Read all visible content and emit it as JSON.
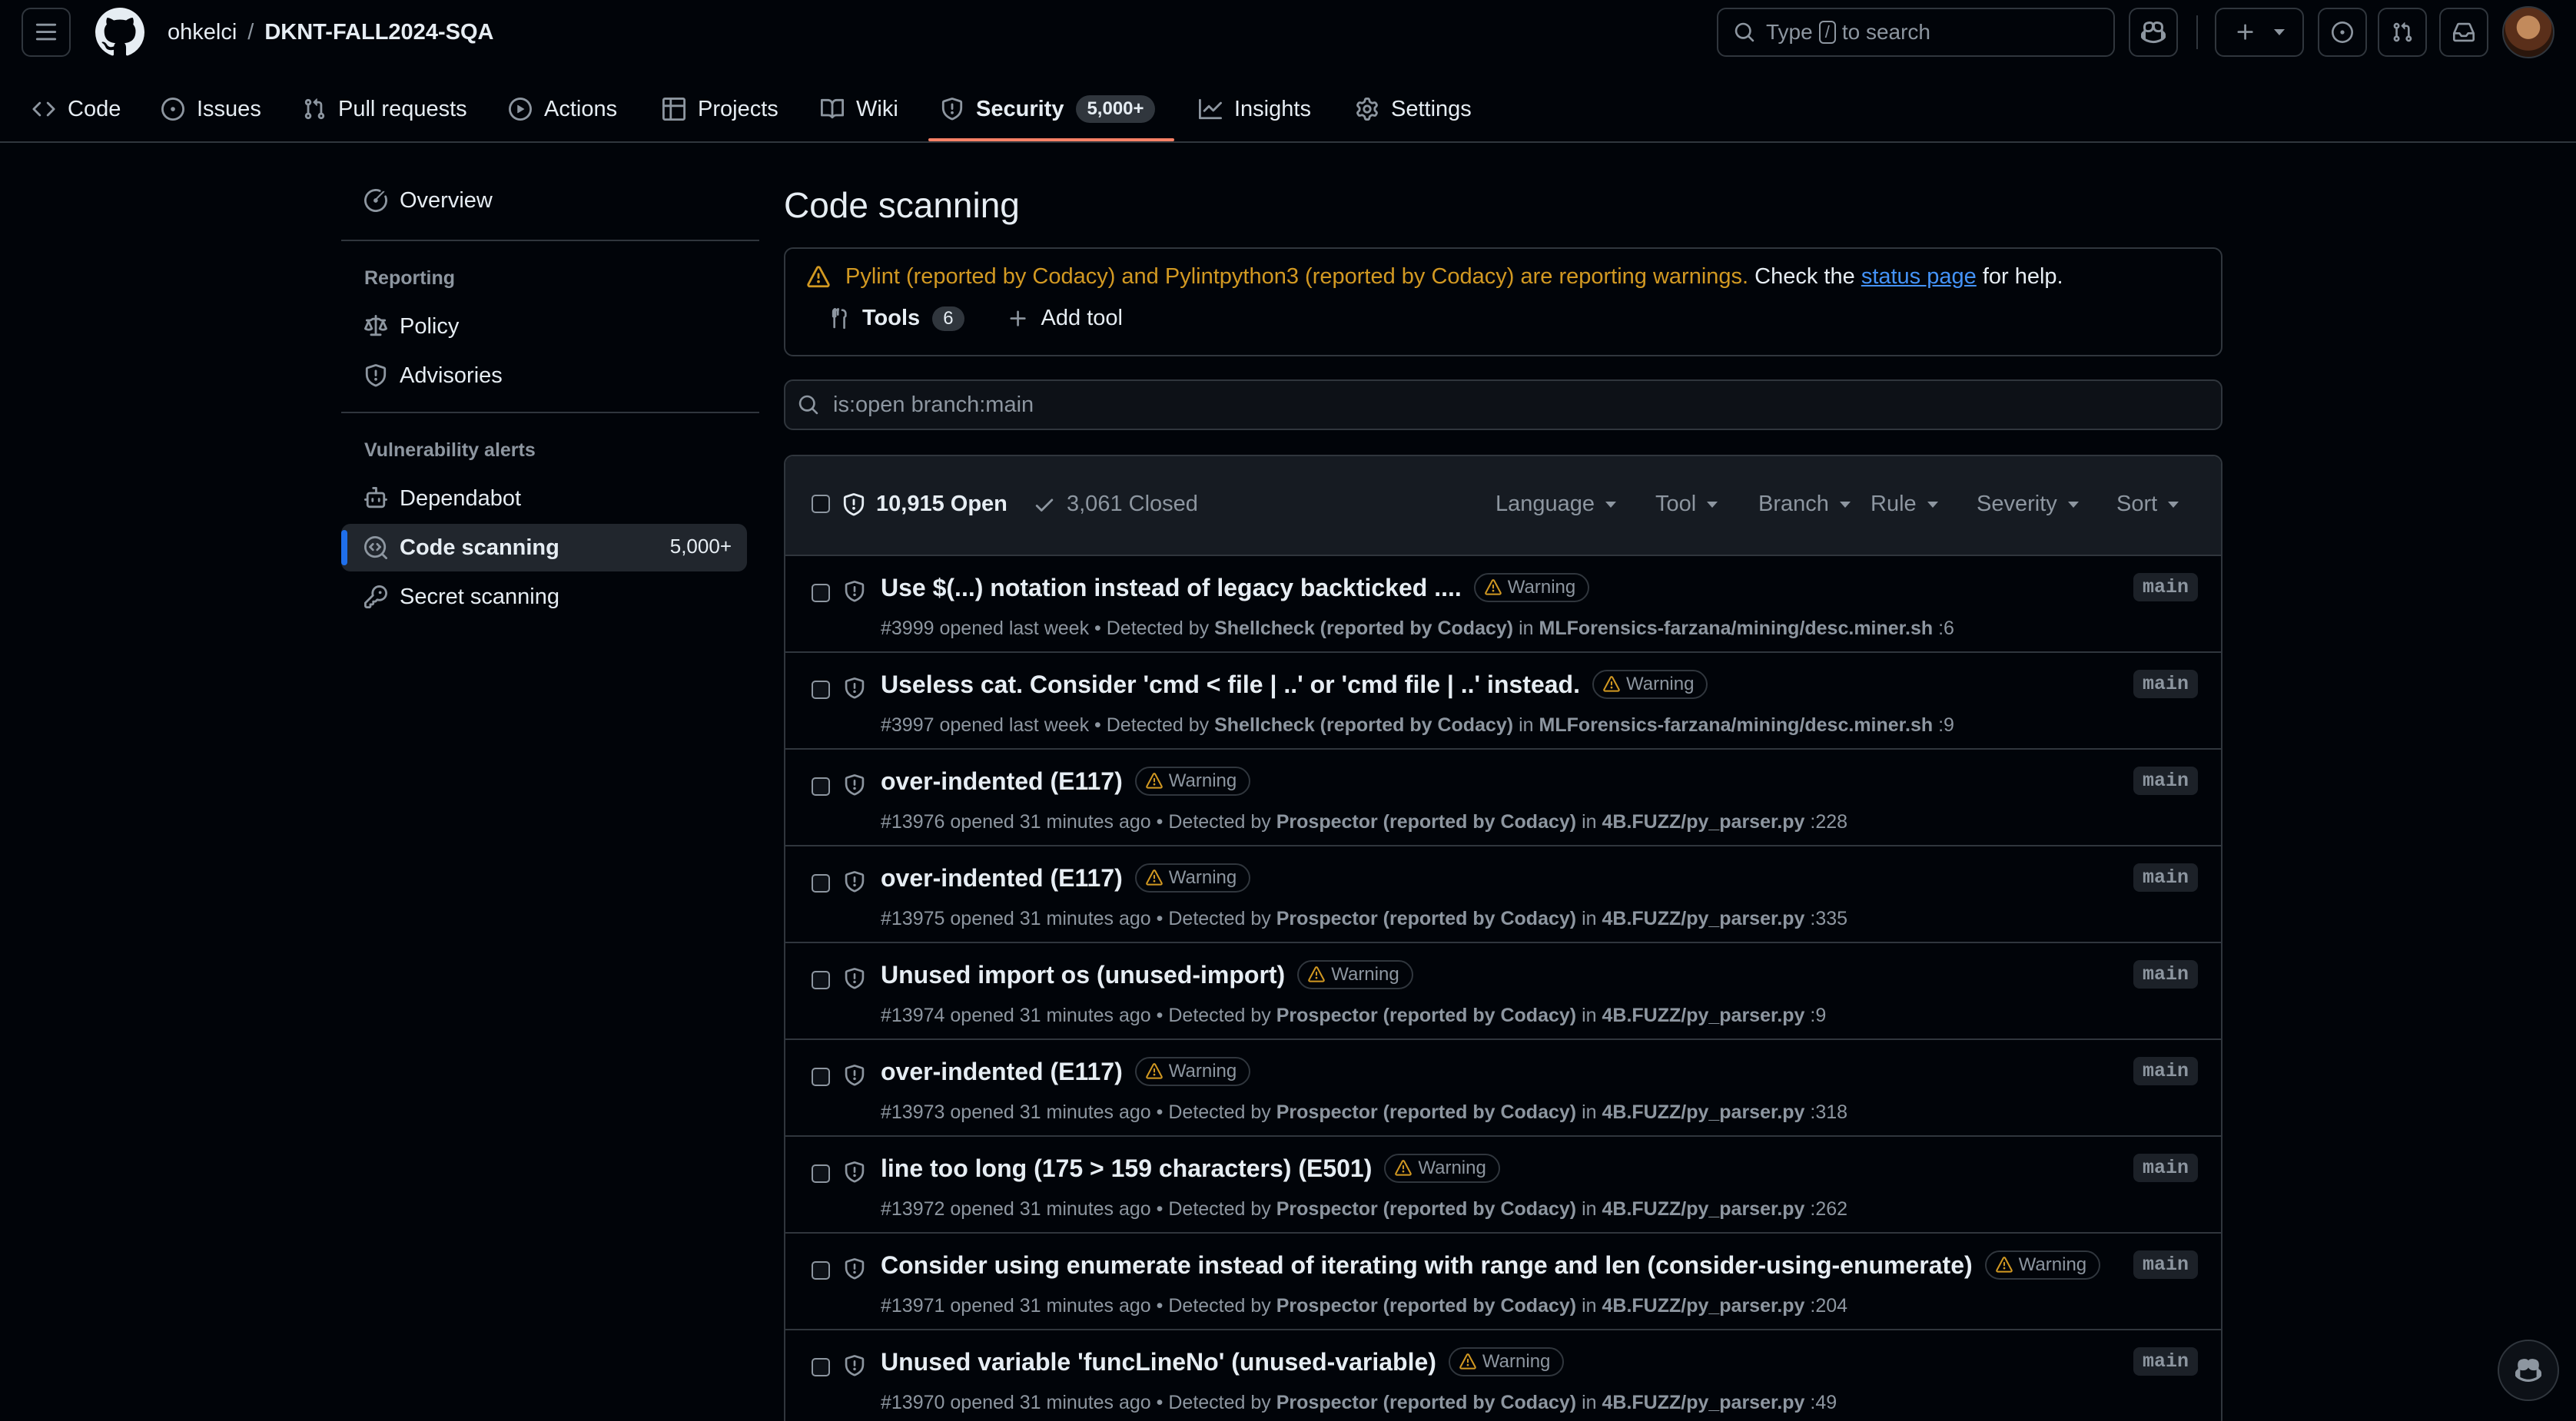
{
  "header": {
    "owner": "ohkelci",
    "separator": "/",
    "repo": "DKNT-FALL2024-SQA",
    "search": {
      "prefix": "Type",
      "key": "/",
      "suffix": "to search"
    }
  },
  "repo_nav": [
    {
      "label": "Code",
      "icon": "code-icon"
    },
    {
      "label": "Issues",
      "icon": "issue-opened-icon"
    },
    {
      "label": "Pull requests",
      "icon": "git-pull-request-icon"
    },
    {
      "label": "Actions",
      "icon": "play-icon"
    },
    {
      "label": "Projects",
      "icon": "table-icon"
    },
    {
      "label": "Wiki",
      "icon": "book-icon"
    },
    {
      "label": "Security",
      "icon": "shield-icon",
      "count": "5,000+",
      "active": true
    },
    {
      "label": "Insights",
      "icon": "graph-icon"
    },
    {
      "label": "Settings",
      "icon": "gear-icon"
    }
  ],
  "sidebar": {
    "overview": "Overview",
    "reporting_heading": "Reporting",
    "policy": "Policy",
    "advisories": "Advisories",
    "vuln_heading": "Vulnerability alerts",
    "dependabot": "Dependabot",
    "code_scanning": "Code scanning",
    "code_scanning_count": "5,000+",
    "secret_scanning": "Secret scanning"
  },
  "main": {
    "title": "Code scanning",
    "notice": {
      "warning": "Pylint (reported by Codacy) and Pylintpython3 (reported by Codacy) are reporting warnings.",
      "check_the": "Check the",
      "link": "status page",
      "for_help": "for help.",
      "tools_label": "Tools",
      "tools_count": "6",
      "add_tool": "Add tool"
    },
    "filter_value": "is:open branch:main",
    "open_count": "10,915 Open",
    "closed_count": "3,061 Closed",
    "filters": [
      "Language",
      "Tool",
      "Branch",
      "Rule",
      "Severity",
      "Sort"
    ]
  },
  "alerts": [
    {
      "title": "Use $(...) notation instead of legacy backticked ....",
      "badge": "Warning",
      "number": "#3999",
      "opened": "opened last week",
      "detected_by_label": "Detected by",
      "tool": "Shellcheck (reported by Codacy)",
      "in_label": "in",
      "path": "MLForensics-farzana/mining/desc.miner.sh",
      "line": ":6",
      "branch": "main"
    },
    {
      "title": "Useless cat. Consider 'cmd < file | ..' or 'cmd file | ..' instead.",
      "badge": "Warning",
      "number": "#3997",
      "opened": "opened last week",
      "detected_by_label": "Detected by",
      "tool": "Shellcheck (reported by Codacy)",
      "in_label": "in",
      "path": "MLForensics-farzana/mining/desc.miner.sh",
      "line": ":9",
      "branch": "main"
    },
    {
      "title": "over-indented (E117)",
      "badge": "Warning",
      "number": "#13976",
      "opened": "opened 31 minutes ago",
      "detected_by_label": "Detected by",
      "tool": "Prospector (reported by Codacy)",
      "in_label": "in",
      "path": "4B.FUZZ/py_parser.py",
      "line": ":228",
      "branch": "main"
    },
    {
      "title": "over-indented (E117)",
      "badge": "Warning",
      "number": "#13975",
      "opened": "opened 31 minutes ago",
      "detected_by_label": "Detected by",
      "tool": "Prospector (reported by Codacy)",
      "in_label": "in",
      "path": "4B.FUZZ/py_parser.py",
      "line": ":335",
      "branch": "main"
    },
    {
      "title": "Unused import os (unused-import)",
      "badge": "Warning",
      "number": "#13974",
      "opened": "opened 31 minutes ago",
      "detected_by_label": "Detected by",
      "tool": "Prospector (reported by Codacy)",
      "in_label": "in",
      "path": "4B.FUZZ/py_parser.py",
      "line": ":9",
      "branch": "main"
    },
    {
      "title": "over-indented (E117)",
      "badge": "Warning",
      "number": "#13973",
      "opened": "opened 31 minutes ago",
      "detected_by_label": "Detected by",
      "tool": "Prospector (reported by Codacy)",
      "in_label": "in",
      "path": "4B.FUZZ/py_parser.py",
      "line": ":318",
      "branch": "main"
    },
    {
      "title": "line too long (175 > 159 characters) (E501)",
      "badge": "Warning",
      "number": "#13972",
      "opened": "opened 31 minutes ago",
      "detected_by_label": "Detected by",
      "tool": "Prospector (reported by Codacy)",
      "in_label": "in",
      "path": "4B.FUZZ/py_parser.py",
      "line": ":262",
      "branch": "main"
    },
    {
      "title": "Consider using enumerate instead of iterating with range and len (consider-using-enumerate)",
      "badge": "Warning",
      "number": "#13971",
      "opened": "opened 31 minutes ago",
      "detected_by_label": "Detected by",
      "tool": "Prospector (reported by Codacy)",
      "in_label": "in",
      "path": "4B.FUZZ/py_parser.py",
      "line": ":204",
      "branch": "main"
    },
    {
      "title": "Unused variable 'funcLineNo' (unused-variable)",
      "badge": "Warning",
      "number": "#13970",
      "opened": "opened 31 minutes ago",
      "detected_by_label": "Detected by",
      "tool": "Prospector (reported by Codacy)",
      "in_label": "in",
      "path": "4B.FUZZ/py_parser.py",
      "line": ":49",
      "branch": "main"
    }
  ],
  "colors": {
    "background": "#010409",
    "border": "#30363d",
    "accent_underline": "#f78166",
    "warning": "#d29922",
    "link": "#4493f8",
    "active_bar": "#1f6feb"
  }
}
